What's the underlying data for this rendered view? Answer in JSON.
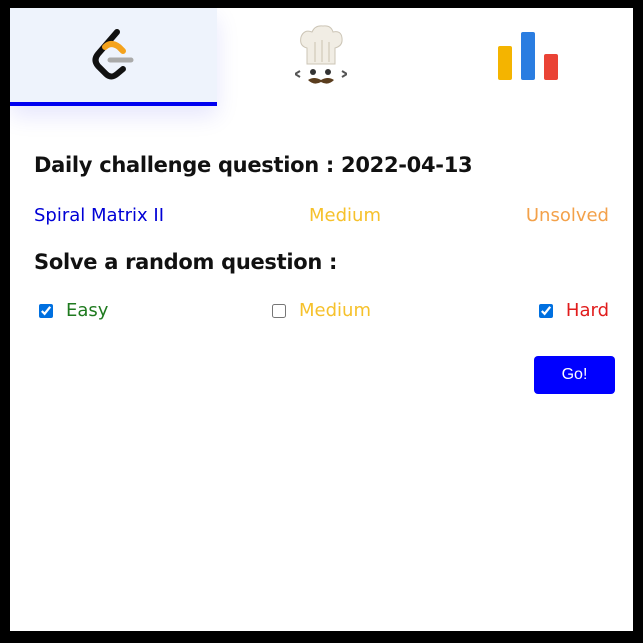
{
  "tabs": [
    {
      "icon": "leetcode-logo-icon",
      "active": true
    },
    {
      "icon": "chef-hat-icon",
      "active": false
    },
    {
      "icon": "bar-chart-icon",
      "active": false
    }
  ],
  "daily": {
    "heading": "Daily challenge question : 2022-04-13",
    "question_title": "Spiral Matrix II",
    "difficulty": "Medium",
    "status": "Unsolved"
  },
  "random": {
    "heading": "Solve a random question :",
    "options": [
      {
        "label": "Easy",
        "checked": true,
        "color": "#1f7a1f"
      },
      {
        "label": "Medium",
        "checked": false,
        "color": "#f6c12b"
      },
      {
        "label": "Hard",
        "checked": true,
        "color": "#e11c1c"
      }
    ],
    "go_label": "Go!"
  },
  "colors": {
    "accent": "#0000ff",
    "active_tab_bg": "#eef3fc",
    "medium": "#f6c12b",
    "unsolved": "#f3a14a"
  }
}
